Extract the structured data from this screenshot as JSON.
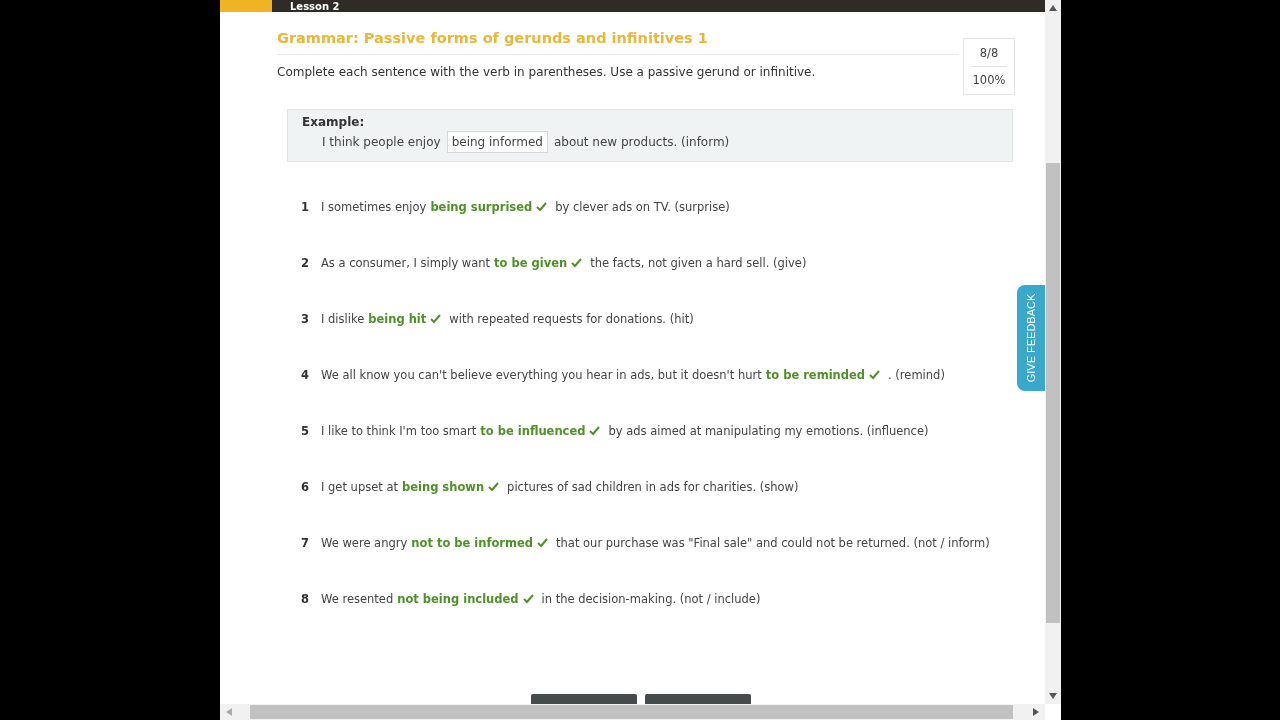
{
  "header": {
    "lesson": "Lesson 2"
  },
  "exercise": {
    "title": "Grammar: Passive forms of gerunds and infinitives 1",
    "instructions": "Complete each sentence with the verb in parentheses. Use a passive gerund or infinitive.",
    "score": "8/8",
    "percent": "100%"
  },
  "example": {
    "label": "Example:",
    "before": "I think people enjoy",
    "answer": "being informed",
    "after": "about new products. (inform)"
  },
  "items": [
    {
      "number": "1",
      "before": "I sometimes enjoy",
      "answer": "being surprised",
      "after": "by clever ads on TV. (surprise)",
      "correct": true
    },
    {
      "number": "2",
      "before": "As a consumer, I simply want",
      "answer": "to be given",
      "after": "the facts, not given a hard sell. (give)",
      "correct": true
    },
    {
      "number": "3",
      "before": "I dislike",
      "answer": "being hit",
      "after": "with repeated requests for donations. (hit)",
      "correct": true
    },
    {
      "number": "4",
      "before": "We all know you can't believe everything you hear in ads, but it doesn't hurt",
      "answer": "to be reminded",
      "after": ". (remind)",
      "correct": true
    },
    {
      "number": "5",
      "before": "I like to think I'm too smart",
      "answer": "to be influenced",
      "after": "by ads aimed at manipulating my emotions. (influence)",
      "correct": true
    },
    {
      "number": "6",
      "before": "I get upset at",
      "answer": "being shown",
      "after": "pictures of sad children in ads for charities. (show)",
      "correct": true
    },
    {
      "number": "7",
      "before": "We were angry",
      "answer": "not to be informed",
      "after": "that our purchase was \"Final sale\" and could not be returned. (not / inform)",
      "correct": true
    },
    {
      "number": "8",
      "before": "We resented",
      "answer": "not being included",
      "after": "in the decision-making. (not / include)",
      "correct": true
    }
  ],
  "feedback": {
    "label": "GIVE FEEDBACK"
  }
}
